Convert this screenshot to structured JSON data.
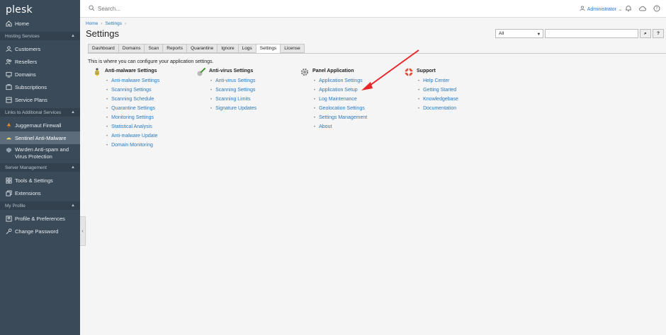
{
  "sidebar": {
    "logo": "plesk",
    "home": "Home",
    "sections": [
      {
        "title": "Hosting Services",
        "items": [
          "Customers",
          "Resellers",
          "Domains",
          "Subscriptions",
          "Service Plans"
        ]
      },
      {
        "title": "Links to Additional Services",
        "items": [
          "Juggernaut Firewall",
          "Sentinel Anti-Malware",
          "Warden Anti-spam and",
          "Virus Protection"
        ]
      },
      {
        "title": "Server Management",
        "items": [
          "Tools & Settings",
          "Extensions"
        ]
      },
      {
        "title": "My Profile",
        "items": [
          "Profile & Preferences",
          "Change Password"
        ]
      }
    ]
  },
  "topbar": {
    "search_placeholder": "Search...",
    "user": "Administrator"
  },
  "breadcrumb": [
    "Home",
    "Settings"
  ],
  "page_title": "Settings",
  "filter": {
    "select_value": "All",
    "search_button": "⌕",
    "help_button": "?"
  },
  "tabs": [
    "Dashboard",
    "Domains",
    "Scan",
    "Reports",
    "Quarantine",
    "Ignore",
    "Logs",
    "Settings",
    "License"
  ],
  "intro": "This is where you can configure your application settings.",
  "groups": [
    {
      "title": "Anti-malware Settings",
      "links": [
        "Anti-malware Settings",
        "Scanning Settings",
        "Scanning Schedule",
        "Quarantine Settings",
        "Monitoring Settings",
        "Statistical Analysis",
        "Anti-malware Update",
        "Domain Monitoring"
      ]
    },
    {
      "title": "Anti-virus Settings",
      "links": [
        "Anti-virus Settings",
        "Scanning Settings",
        "Scanning Limits",
        "Signature Updates"
      ]
    },
    {
      "title": "Panel Application",
      "links": [
        "Application Settings",
        "Application Setup",
        "Log Maintenance",
        "Geolocation Settings",
        "Settings Management",
        "About"
      ]
    },
    {
      "title": "Support",
      "links": [
        "Help Center",
        "Getting Started",
        "Knowledgebase",
        "Documentation"
      ]
    }
  ],
  "colors": {
    "sidebar": "#3a4a59",
    "link": "#2a79c2",
    "arrow": "#e8262a"
  }
}
